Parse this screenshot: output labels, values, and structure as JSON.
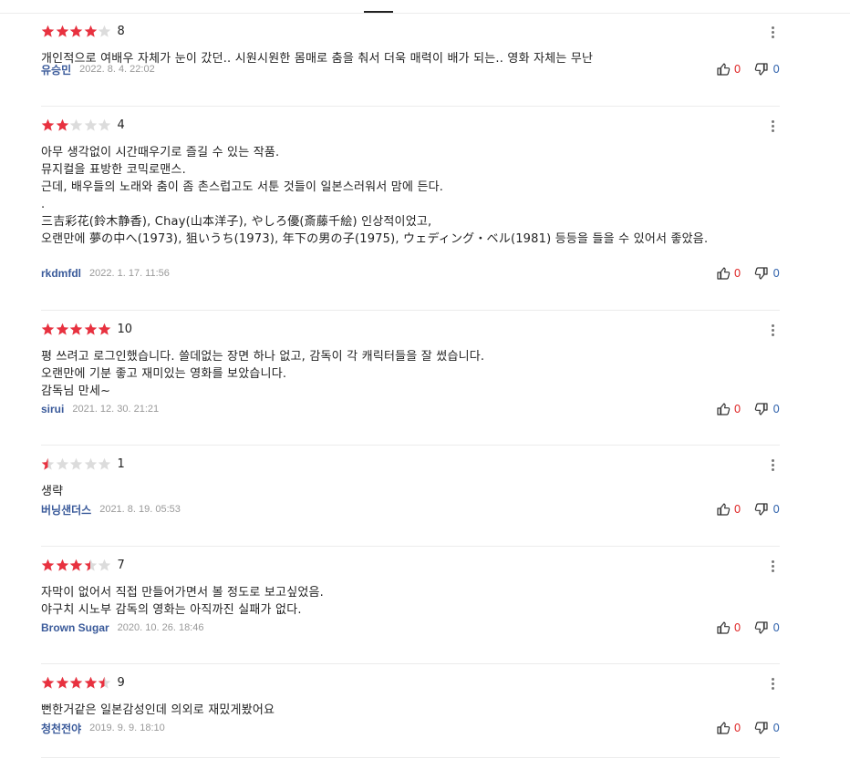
{
  "reviews": [
    {
      "rating": 8,
      "score": "8",
      "text": "개인적으로 여배우 자체가 눈이 갔던.. 시원시원한 몸매로 춤을 춰서 더욱 매력이 배가 되는.. 영화 자체는 무난",
      "author": "유승민",
      "date": "2022. 8. 4. 22:02",
      "likes": "0",
      "dislikes": "0"
    },
    {
      "rating": 4,
      "score": "4",
      "text": "아무 생각없이 시간때우기로 즐길 수 있는 작품.\n뮤지컬을 표방한 코믹로맨스.\n근데, 배우들의 노래와 춤이 좀 촌스럽고도 서툰 것들이 일본스러워서 맘에 든다.\n.\n三吉彩花(鈴木静香), Chay(山本洋子), やしろ優(斎藤千絵) 인상적이었고,\n오랜만에 夢の中へ(1973), 狙いうち(1973), 年下の男の子(1975), ウェディング・ベル(1981) 등등을 들을 수 있어서 좋았음.",
      "author": "rkdmfdl",
      "date": "2022. 1. 17. 11:56",
      "likes": "0",
      "dislikes": "0"
    },
    {
      "rating": 10,
      "score": "10",
      "text": "평 쓰려고 로그인했습니다. 쓸데없는 장면 하나 없고, 감독이 각 캐릭터들을 잘 썼습니다.\n오랜만에 기분 좋고 재미있는 영화를 보았습니다.\n감독님 만세~",
      "author": "sirui",
      "date": "2021. 12. 30. 21:21",
      "likes": "0",
      "dislikes": "0"
    },
    {
      "rating": 1,
      "score": "1",
      "text": "생략",
      "author": "버닝샌더스",
      "date": "2021. 8. 19. 05:53",
      "likes": "0",
      "dislikes": "0"
    },
    {
      "rating": 7,
      "score": "7",
      "text": "자막이 없어서 직접 만들어가면서 볼 정도로 보고싶었음.\n야구치 시노부 감독의 영화는 아직까진 실패가 없다.",
      "author": "Brown Sugar",
      "date": "2020. 10. 26. 18:46",
      "likes": "0",
      "dislikes": "0"
    },
    {
      "rating": 9,
      "score": "9",
      "text": "뻔한거같은 일본감성인데 의외로 재밌게봤어요",
      "author": "청천전야",
      "date": "2019. 9. 9. 18:10",
      "likes": "0",
      "dislikes": "0"
    }
  ],
  "colors": {
    "star_on": "#e8313f",
    "star_off": "#dcdcdc",
    "author": "#3a5a9a",
    "like_count": "#e03030",
    "dislike_count": "#3a6ab0"
  },
  "icons": {
    "more": "more-vertical-icon",
    "like": "thumbs-up-icon",
    "dislike": "thumbs-down-icon",
    "star": "star-icon"
  }
}
